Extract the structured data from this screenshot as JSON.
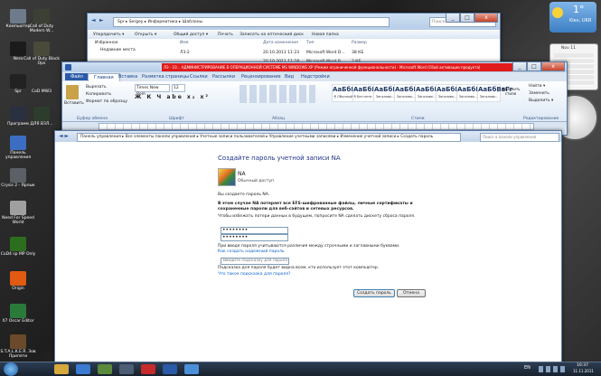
{
  "desktop": {
    "icons": [
      {
        "label": "Компьютер",
        "color": "#6d7b8a"
      },
      {
        "label": "Call of Duty Modern W...",
        "color": "#3c3f33"
      },
      {
        "label": "Nero",
        "color": "#1b1b1b"
      },
      {
        "label": "Call of Duty Black Ops",
        "color": "#4a4a3a"
      },
      {
        "label": "Spr",
        "color": "#222"
      },
      {
        "label": "CoD MW3",
        "color": "#333"
      },
      {
        "label": "Программ",
        "color": "#2a3040"
      },
      {
        "label": "ДЛЯ ВЗЛ...",
        "color": "#2d3d2d"
      },
      {
        "label": "Панель управления",
        "color": "#3b6dc2"
      },
      {
        "label": "Crysis 2 - Ярлык",
        "color": "#5b6066"
      },
      {
        "label": "Need For Speed World",
        "color": "#a0a0a0"
      },
      {
        "label": "CoD4 sp MP Only",
        "color": "#2c6e1e"
      },
      {
        "label": "Origin",
        "color": "#e05a12"
      },
      {
        "label": "X7 Oscar Editor",
        "color": "#2a7a3a"
      },
      {
        "label": "S.T.A.L.K.E.R. Зов Припяти",
        "color": "#6a4a2a"
      }
    ]
  },
  "gadgets": {
    "weather_temp": "1°",
    "weather_place": "Kiev, UKR",
    "calendar_title": "Nov 11"
  },
  "explorer": {
    "back": "◄",
    "forward": "►",
    "path": [
      "Spr",
      "Sergey",
      "Информатика",
      "Шаблоны"
    ],
    "search_placeholder": "Поиск: Шаблоны",
    "toolbar": [
      "Упорядочить ▾",
      "Открыть ▾",
      "Общий доступ ▾",
      "Печать",
      "Записать на оптический диск",
      "Новая папка"
    ],
    "nav": [
      "Избранное",
      "Недавние места"
    ],
    "columns": [
      "Имя",
      "Дата изменения",
      "Тип",
      "Размер"
    ],
    "row": {
      "name": "Л3-2",
      "date": "20.10.2011 11:23",
      "type": "Microsoft Word D...",
      "size": "38 КБ"
    },
    "row2": {
      "date": "20.10.2011 11:18",
      "type": "Microsoft Word 9...",
      "size": "2 КБ"
    }
  },
  "word": {
    "title": "ЛЗ - 10... АДМИНИСТРИРОВАНИЕ В ОПЕРАЦИОННОЙ СИСТЕМЕ MS WINDOWS XP (Режим ограниченной функциональности) - Microsoft Word (Сбой активации продукта)",
    "file_tab": "Файл",
    "tabs": [
      "Главная",
      "Вставка",
      "Разметка страницы",
      "Ссылки",
      "Рассылки",
      "Рецензирование",
      "Вид",
      "Надстройки"
    ],
    "paste_label": "Вставить",
    "clipboard": [
      "Вырезать",
      "Копировать",
      "Формат по образцу"
    ],
    "font_name": "Times New Rom",
    "font_size": "12",
    "groups": [
      "Буфер обмена",
      "Шрифт",
      "Абзац",
      "Стили",
      "Редактирование"
    ],
    "styles": [
      {
        "sample": "АаБбВ",
        "label": "¶ Обычный"
      },
      {
        "sample": "АаБбВ",
        "label": "¶ Без инте..."
      },
      {
        "sample": "АаБбВ",
        "label": "Заголово..."
      },
      {
        "sample": "АаБбВ",
        "label": "Заголово..."
      },
      {
        "sample": "АаБбВг",
        "label": "Заголово..."
      },
      {
        "sample": "АаБбВвГ",
        "label": "Заголово..."
      },
      {
        "sample": "АаБбВвГ",
        "label": "Заголово..."
      },
      {
        "sample": "АаБбВвГг",
        "label": "Заголово..."
      }
    ],
    "change_styles": "Изменить стили",
    "editing": [
      "Найти ▾",
      "Заменить",
      "Выделить ▾"
    ]
  },
  "control_panel": {
    "breadcrumb": [
      "Панель управления",
      "Все элементы панели управления",
      "Учетные записи пользователей",
      "Управление учетными записями",
      "Изменение учетной записи",
      "Создать пароль"
    ],
    "search_placeholder": "Поиск в панели управления",
    "heading": "Создайте пароль учетной записи NA",
    "user_name": "NA",
    "user_type": "Обычный доступ",
    "intro": "Вы создаете пароль NA.",
    "warning": "В этом случае NA потеряет все EFS-шифрованные файлы, личные сертификаты и сохраненные пароли для веб-сайтов и сетевых ресурсов.",
    "reset_hint": "Чтобы избежать потери данных в будущем, попросите NA сделать дискету сброса пароля.",
    "password_mask": "••••••••",
    "password_confirm_mask": "••••••••",
    "case_note": "При вводе пароля учитываются различия между строчными и заглавными буквами.",
    "strong_link": "Как создать надежный пароль",
    "hint_placeholder": "Введите подсказку для пароля",
    "hint_note": "Подсказка для пароля будет видна всем, кто использует этот компьютер.",
    "hint_link": "Что такое подсказка для пароля?",
    "create_button": "Создать пароль",
    "cancel_button": "Отмена"
  },
  "taskbar": {
    "lang": "EN",
    "time": "10:37",
    "date": "11.11.2011"
  }
}
